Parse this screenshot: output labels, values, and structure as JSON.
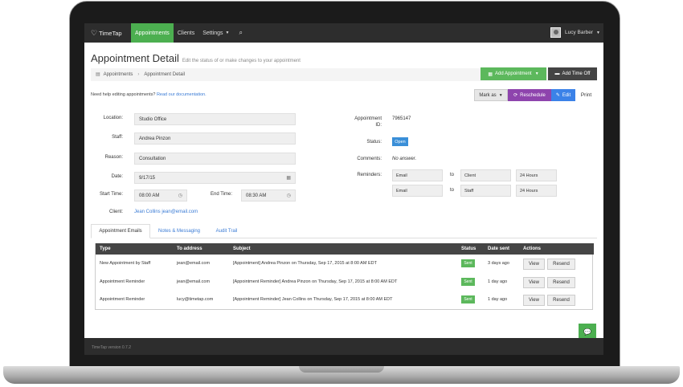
{
  "app": {
    "logo_text": "TimeTap",
    "nav": {
      "appointments": "Appointments",
      "clients": "Clients",
      "settings": "Settings"
    },
    "user": {
      "name": "Lucy Barber"
    }
  },
  "page": {
    "title": "Appointment Detail",
    "subtitle": "Edit the status of or make changes to your appointment",
    "breadcrumb": [
      "Appointments",
      "Appointment Detail"
    ],
    "help_text": "Need help editing appointments?",
    "help_link": "Read our documentation."
  },
  "actions": {
    "add_appointment": "Add Appointment",
    "add_time_off": "Add Time Off",
    "mark_as": "Mark as",
    "reschedule": "Reschedule",
    "edit": "Edit",
    "print": "Print"
  },
  "form": {
    "location_label": "Location:",
    "location": "Studio Office",
    "staff_label": "Staff:",
    "staff": "Andrea Pinzon",
    "reason_label": "Reason:",
    "reason": "Consultation",
    "date_label": "Date:",
    "date": "9/17/15",
    "start_time_label": "Start Time:",
    "start_time": "08:00 AM",
    "end_time_label": "End Time:",
    "end_time": "08:30 AM",
    "client_label": "Client:",
    "client": "Jean Collins jean@email.com",
    "appointment_id_label_1": "Appointment",
    "appointment_id_label_2": "ID:",
    "appointment_id": "7965147",
    "status_label": "Status:",
    "status": "Open",
    "comments_label": "Comments:",
    "comments": "No answer.",
    "reminders_label": "Reminders:",
    "reminders": [
      {
        "method": "Email",
        "to_word": "to",
        "recipient": "Client",
        "time": "24 Hours"
      },
      {
        "method": "Email",
        "to_word": "to",
        "recipient": "Staff",
        "time": "24 Hours"
      }
    ]
  },
  "tabs": [
    "Appointment Emails",
    "Notes & Messaging",
    "Audit Trail"
  ],
  "table": {
    "headers": [
      "Type",
      "To address",
      "Subject",
      "Status",
      "Date sent",
      "Actions"
    ],
    "rows": [
      {
        "type": "New Appointment by Staff",
        "to": "jean@email.com",
        "subject": "[Appointment] Andrea Pinzon on Thursday, Sep 17, 2015 at 8:00 AM EDT",
        "status": "Sent",
        "date_sent": "3 days ago",
        "view": "View",
        "resend": "Resend"
      },
      {
        "type": "Appointment Reminder",
        "to": "jean@email.com",
        "subject": "[Appointment Reminder] Andrea Pinzon on Thursday, Sep 17, 2015 at 8:00 AM EDT",
        "status": "Sent",
        "date_sent": "1 day ago",
        "view": "View",
        "resend": "Resend"
      },
      {
        "type": "Appointment Reminder",
        "to": "lucy@timetap.com",
        "subject": "[Appointment Reminder] Jean Collins on Thursday, Sep 17, 2015 at 8:00 AM EDT",
        "status": "Sent",
        "date_sent": "1 day ago",
        "view": "View",
        "resend": "Resend"
      }
    ]
  },
  "footer": {
    "version": "TimeTap version 0.7.2"
  },
  "colors": {
    "nav_active": "#4caf50",
    "reschedule": "#8e44ad",
    "edit": "#3b82e8",
    "status_open": "#3a8fd8",
    "sent": "#5cb85c",
    "link": "#3a7bd5"
  },
  "icons": [
    "calendar-icon",
    "clock-icon",
    "refresh-icon",
    "pencil-icon",
    "search-icon",
    "chat-icon",
    "document-icon"
  ]
}
